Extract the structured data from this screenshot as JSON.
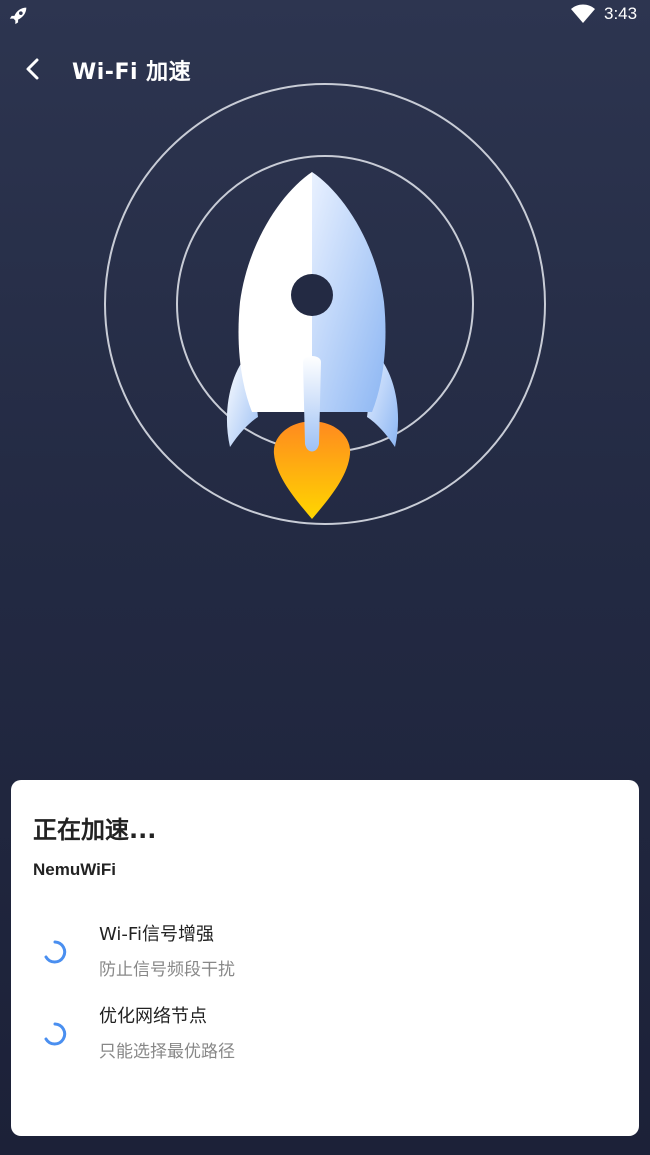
{
  "status_bar": {
    "time": "3:43",
    "left_icon": "rocket-icon",
    "right_icon": "wifi-icon"
  },
  "header": {
    "title": "Wi-Fi 加速",
    "back_icon": "chevron-left-icon"
  },
  "hero": {
    "illustration": "rocket-icon",
    "colors": {
      "ring": "#c8ccd6",
      "rocket_body": "#ffffff",
      "rocket_shade": "#9ec1f5",
      "flame_top": "#ff8a1f",
      "flame_bottom": "#ffd600"
    }
  },
  "card": {
    "title": "正在加速...",
    "network_name": "NemuWiFi",
    "tasks": [
      {
        "title": "Wi-Fi信号增强",
        "description": "防止信号频段干扰",
        "icon": "spinner-icon"
      },
      {
        "title": "优化网络节点",
        "description": "只能选择最优路径",
        "icon": "spinner-icon"
      }
    ],
    "colors": {
      "spinner": "#4a8ff0"
    }
  }
}
